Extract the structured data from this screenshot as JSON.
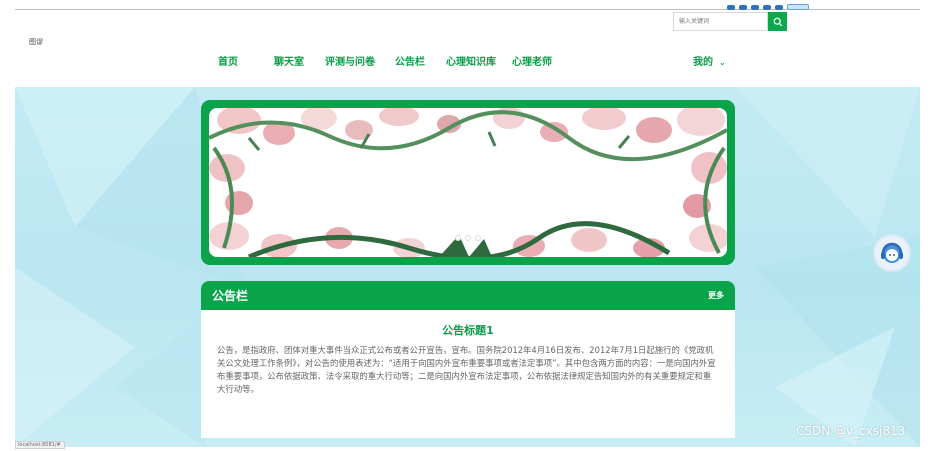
{
  "header": {
    "logo_text": "图谬",
    "search": {
      "placeholder": "输入关键词"
    }
  },
  "nav": {
    "items": [
      {
        "label": "首页"
      },
      {
        "label": "聊天室"
      },
      {
        "label": "评测与问卷"
      },
      {
        "label": "公告栏"
      },
      {
        "label": "心理知识库"
      },
      {
        "label": "心理老师"
      }
    ],
    "user_menu": {
      "label": "我的",
      "caret": "⌄"
    }
  },
  "banner": {
    "slide_count": 3
  },
  "notice": {
    "title": "公告栏",
    "more": "更多",
    "item_title": "公告标题1",
    "item_body": "公告，是指政府、团体对重大事件当众正式公布或者公开宣告，宣布。国务院2012年4月16日发布、2012年7月1日起施行的《党政机关公文处理工作条例》，对公告的使用表述为：“适用于向国内外宣布重要事项或者法定事项”。其中包含两方面的内容：一是向国内外宣布重要事项，公布依据政策、法令采取的重大行动等；二是向国内外宣布法定事项，公布依据法律规定告知国内外的有关重要规定和重大行动等。"
  },
  "watermark": "CSDN @v_cxsj813",
  "status_url": "localhost:8081/#",
  "colors": {
    "brand_green": "#0aa34a",
    "nav_green": "#0c9c48",
    "background_sky": "#c4ebf4"
  },
  "icons": {
    "search": "search-icon",
    "service": "customer-service-icon"
  }
}
